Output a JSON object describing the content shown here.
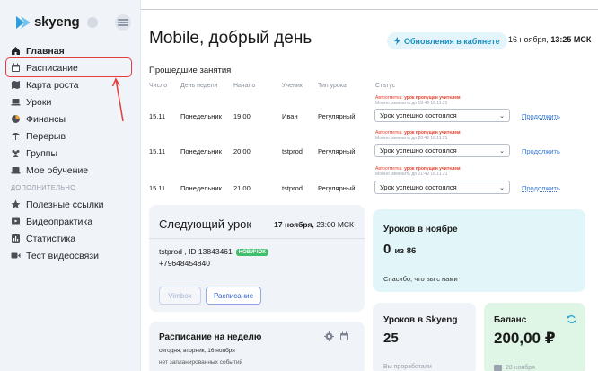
{
  "logo": {
    "text": "skyeng"
  },
  "sidebar": {
    "items": [
      {
        "label": "Главная",
        "icon": "home-icon"
      },
      {
        "label": "Расписание",
        "icon": "calendar-icon"
      },
      {
        "label": "Карта роста",
        "icon": "map-icon"
      },
      {
        "label": "Уроки",
        "icon": "laptop-icon"
      },
      {
        "label": "Финансы",
        "icon": "finance-icon"
      },
      {
        "label": "Перерыв",
        "icon": "pause-icon"
      },
      {
        "label": "Группы",
        "icon": "group-icon"
      },
      {
        "label": "Мое обучение",
        "icon": "learning-icon"
      }
    ],
    "section_label": "ДОПОЛНИТЕЛЬНО",
    "extra_items": [
      {
        "label": "Полезные ссылки",
        "icon": "star-icon"
      },
      {
        "label": "Видеопрактика",
        "icon": "video-practice-icon"
      },
      {
        "label": "Статистика",
        "icon": "stats-icon"
      },
      {
        "label": "Тест видеосвязи",
        "icon": "camera-icon"
      }
    ]
  },
  "header": {
    "greeting": "Mobile, добрый день",
    "updates_label": "Обновления в кабинете",
    "date_text": "16 ноября,",
    "time_text": "13:25 МСК"
  },
  "past_lessons": {
    "title": "Прошедшие занятия",
    "columns": [
      "Число",
      "День недели",
      "Начало",
      "Ученик",
      "Тип урока",
      "Статус"
    ],
    "rows": [
      {
        "date": "15.11",
        "day": "Понедельник",
        "start": "19:00",
        "student": "Иван",
        "type": "Регулярный",
        "auto_label": "Автоотметка:",
        "auto_value": "урок пропущен учителем",
        "edit_until": "Можно изменить до 19:49 16.11.21",
        "status": "Урок успешно состоялся",
        "action": "Продолжить"
      },
      {
        "date": "15.11",
        "day": "Понедельник",
        "start": "20:00",
        "student": "tstprod",
        "type": "Регулярный",
        "auto_label": "Автоотметка:",
        "auto_value": "урок пропущен учителем",
        "edit_until": "Можно изменить до 20:49 16.11.21",
        "status": "Урок успешно состоялся",
        "action": "Продолжить"
      },
      {
        "date": "15.11",
        "day": "Понедельник",
        "start": "21:00",
        "student": "tstprod",
        "type": "Регулярный",
        "auto_label": "Автоотметка:",
        "auto_value": "урок пропущен учителем",
        "edit_until": "Можно изменить до 21:49 16.11.21",
        "status": "Урок успешно состоялся",
        "action": "Продолжить"
      }
    ]
  },
  "next_lesson": {
    "title": "Следующий урок",
    "date_text": "17 ноября,",
    "time_text": "23:00 МСК",
    "student": "tstprod , ID 13843461",
    "badge": "НОВИЧОК",
    "phone": "+79648454840",
    "vimbox_label": "Vimbox",
    "schedule_label": "Расписание"
  },
  "month_stats": {
    "title": "Уроков в ноябре",
    "count": "0",
    "of_label": "из 86",
    "thanks": "Спасибо, что вы с нами"
  },
  "week_schedule": {
    "title": "Расписание на неделю",
    "today": "сегодня, вторник, 16 ноября",
    "empty": "нет запланированных событий"
  },
  "skyeng_stats": {
    "title": "Уроков в Skyeng",
    "count": "25",
    "footer": "Вы проработали"
  },
  "balance": {
    "title": "Баланс",
    "amount": "200,00 ₽",
    "footer": "28 ноября"
  },
  "colors": {
    "accent": "#1a8fc0",
    "highlight": "#e53d3d",
    "link": "#3a7bd5",
    "new_badge": "#3dbf6e"
  }
}
